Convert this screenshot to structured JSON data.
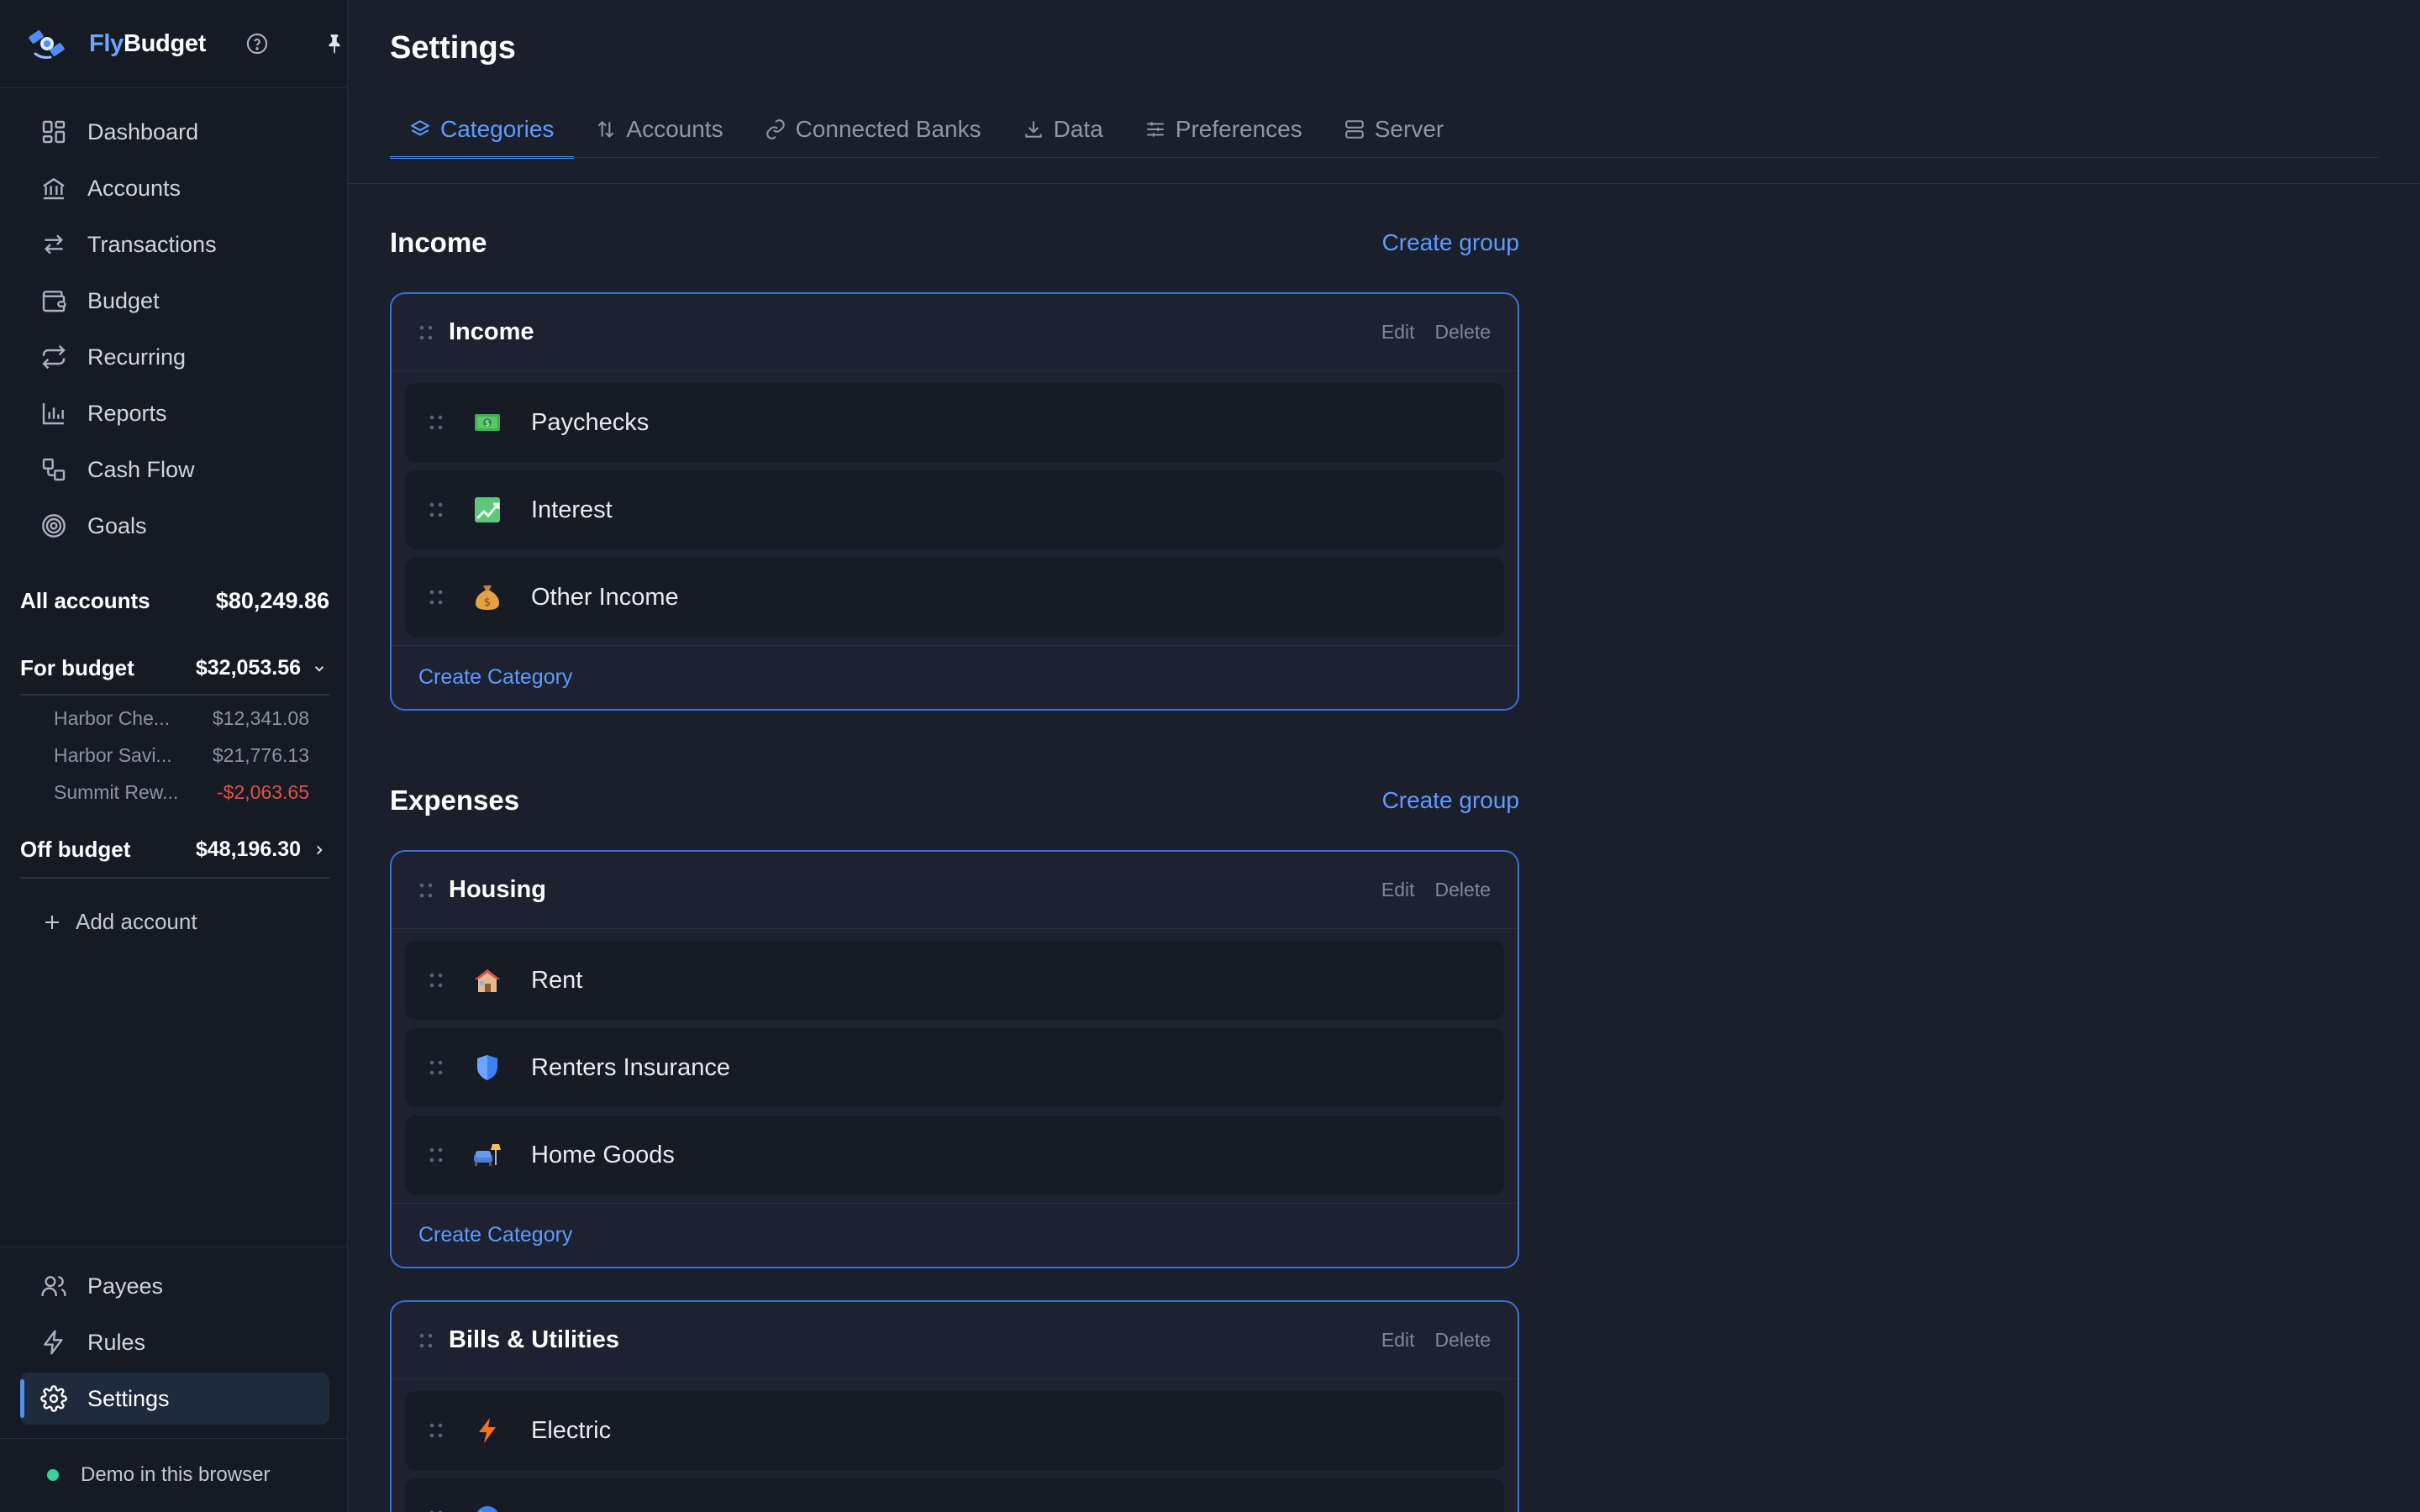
{
  "brand": {
    "part1": "Fly",
    "part2": "Budget"
  },
  "nav": [
    {
      "label": "Dashboard",
      "icon": "dashboard-icon"
    },
    {
      "label": "Accounts",
      "icon": "bank-icon"
    },
    {
      "label": "Transactions",
      "icon": "arrows-left-right-icon"
    },
    {
      "label": "Budget",
      "icon": "wallet-icon"
    },
    {
      "label": "Recurring",
      "icon": "repeat-icon"
    },
    {
      "label": "Reports",
      "icon": "bar-chart-icon"
    },
    {
      "label": "Cash Flow",
      "icon": "cash-flow-icon"
    },
    {
      "label": "Goals",
      "icon": "target-icon"
    }
  ],
  "accounts": {
    "all_label": "All accounts",
    "all_amount": "$80,249.86",
    "for_budget": {
      "label": "For budget",
      "amount": "$32,053.56",
      "items": [
        {
          "name": "Harbor Che...",
          "amount": "$12,341.08",
          "negative": false
        },
        {
          "name": "Harbor Savi...",
          "amount": "$21,776.13",
          "negative": false
        },
        {
          "name": "Summit Rew...",
          "amount": "-$2,063.65",
          "negative": true
        }
      ]
    },
    "off_budget": {
      "label": "Off budget",
      "amount": "$48,196.30"
    },
    "add_label": "Add account"
  },
  "nav_bottom": [
    {
      "label": "Payees",
      "icon": "users-icon"
    },
    {
      "label": "Rules",
      "icon": "lightning-icon"
    },
    {
      "label": "Settings",
      "icon": "gear-icon",
      "active": true
    }
  ],
  "status": {
    "label": "Demo in this browser",
    "color": "#34d399"
  },
  "page": {
    "title": "Settings"
  },
  "tabs": [
    {
      "label": "Categories",
      "icon": "layers-icon",
      "active": true
    },
    {
      "label": "Accounts",
      "icon": "sort-arrows-icon"
    },
    {
      "label": "Connected Banks",
      "icon": "link-icon"
    },
    {
      "label": "Data",
      "icon": "download-icon"
    },
    {
      "label": "Preferences",
      "icon": "sliders-icon"
    },
    {
      "label": "Server",
      "icon": "server-icon"
    }
  ],
  "sections": {
    "income": {
      "title": "Income",
      "create_group": "Create group",
      "groups": [
        {
          "name": "Income",
          "edit": "Edit",
          "delete": "Delete",
          "create_category": "Create Category",
          "categories": [
            {
              "name": "Paychecks",
              "emoji": "banknote-icon"
            },
            {
              "name": "Interest",
              "emoji": "chart-up-icon"
            },
            {
              "name": "Other Income",
              "emoji": "money-bag-icon"
            }
          ]
        }
      ]
    },
    "expenses": {
      "title": "Expenses",
      "create_group": "Create group",
      "groups": [
        {
          "name": "Housing",
          "edit": "Edit",
          "delete": "Delete",
          "create_category": "Create Category",
          "categories": [
            {
              "name": "Rent",
              "emoji": "house-icon"
            },
            {
              "name": "Renters Insurance",
              "emoji": "shield-icon"
            },
            {
              "name": "Home Goods",
              "emoji": "couch-lamp-icon"
            }
          ]
        },
        {
          "name": "Bills & Utilities",
          "edit": "Edit",
          "delete": "Delete",
          "categories": [
            {
              "name": "Electric",
              "emoji": "lightning-icon"
            }
          ]
        }
      ]
    }
  },
  "colors": {
    "accent": "#5d9bff",
    "negative": "#e2514a",
    "card_border": "#3b6fd1"
  }
}
